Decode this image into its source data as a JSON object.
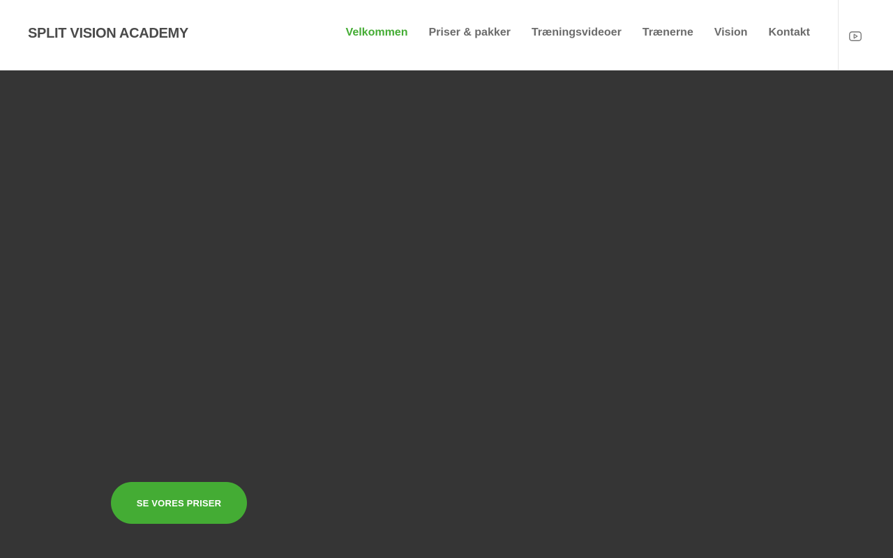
{
  "site": {
    "logo_text": "SPLIT VISION ACADEMY"
  },
  "nav": {
    "items": [
      {
        "label": "Velkommen",
        "active": true
      },
      {
        "label": "Priser & pakker",
        "active": false
      },
      {
        "label": "Træningsvideoer",
        "active": false
      },
      {
        "label": "Trænerne",
        "active": false
      },
      {
        "label": "Vision",
        "active": false
      },
      {
        "label": "Kontakt",
        "active": false
      }
    ]
  },
  "social": {
    "icon": "youtube-icon"
  },
  "hero": {
    "cta_label": "SE VORES PRISER"
  },
  "colors": {
    "accent": "#44ac34",
    "hero_background": "#353535",
    "header_background": "#ffffff",
    "nav_text": "#6b6b6b",
    "logo_text": "#4a4a4a"
  }
}
